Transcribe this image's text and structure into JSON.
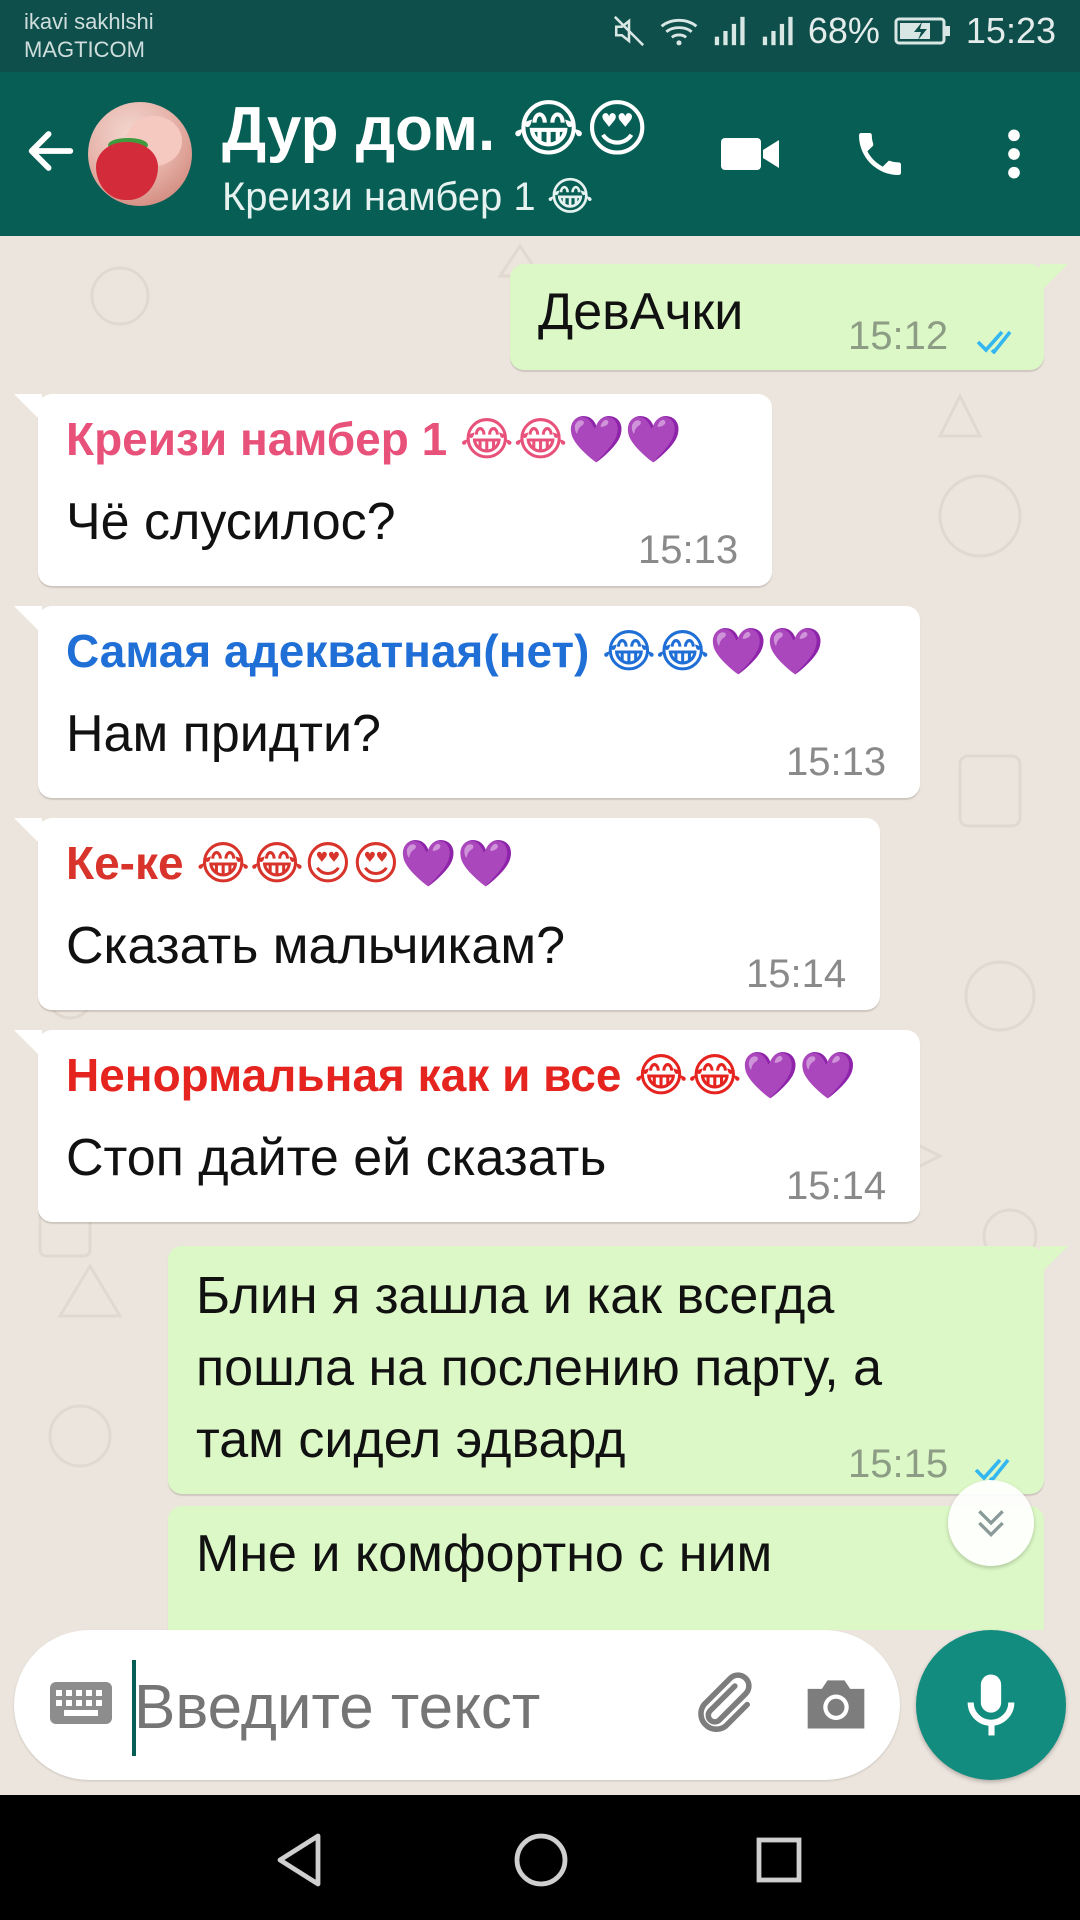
{
  "status_bar": {
    "carrier_line1": "ikavi sakhlshi",
    "carrier_line2": "MAGTICOM",
    "battery": "68%",
    "time": "15:23"
  },
  "header": {
    "title": "Дур дом. 😂😍",
    "subtitle": "Креизи намбер 1 😂",
    "back_icon": "arrow-left-icon",
    "video_icon": "video-camera-icon",
    "call_icon": "phone-icon",
    "more_icon": "more-vertical-icon"
  },
  "messages": [
    {
      "direction": "out",
      "text": "ДевАчки",
      "time": "15:12",
      "read": true
    },
    {
      "direction": "in",
      "sender": "Креизи намбер 1 😂😂💜💜",
      "sender_color": "#e8527a",
      "text": "Чё слусилос?",
      "time": "15:13"
    },
    {
      "direction": "in",
      "sender": "Самая адекватная(нет) 😂😂💜💜",
      "sender_color": "#1f6fd6",
      "text": "Нам придти?",
      "time": "15:13"
    },
    {
      "direction": "in",
      "sender": "Ке-ке 😂😂😍😍💜💜",
      "sender_color": "#d8342b",
      "text": "Сказать мальчикам?",
      "time": "15:14"
    },
    {
      "direction": "in",
      "sender": "Ненормальная как и все 😂😂💜💜",
      "sender_color": "#e52420",
      "text": "Стоп дайте ей сказать",
      "time": "15:14"
    },
    {
      "direction": "out",
      "text": "Блин я зашла и как всегда\nпошла на послению парту, а\nтам сидел эдвард",
      "time": "15:15",
      "read": true
    },
    {
      "direction": "out",
      "text": "Мне и комфортно с ним",
      "time": ""
    }
  ],
  "input": {
    "placeholder": "Введите текст",
    "keyboard_icon": "keyboard-icon",
    "attach_icon": "paperclip-icon",
    "camera_icon": "camera-icon",
    "mic_icon": "microphone-icon"
  },
  "colors": {
    "header": "#075e54",
    "status": "#0f4f4b",
    "outgoing_bubble": "#dcf8c6",
    "incoming_bubble": "#ffffff",
    "chat_bg": "#ece5dd",
    "read_ticks": "#34b7f1",
    "mic_button": "#128c7e"
  }
}
